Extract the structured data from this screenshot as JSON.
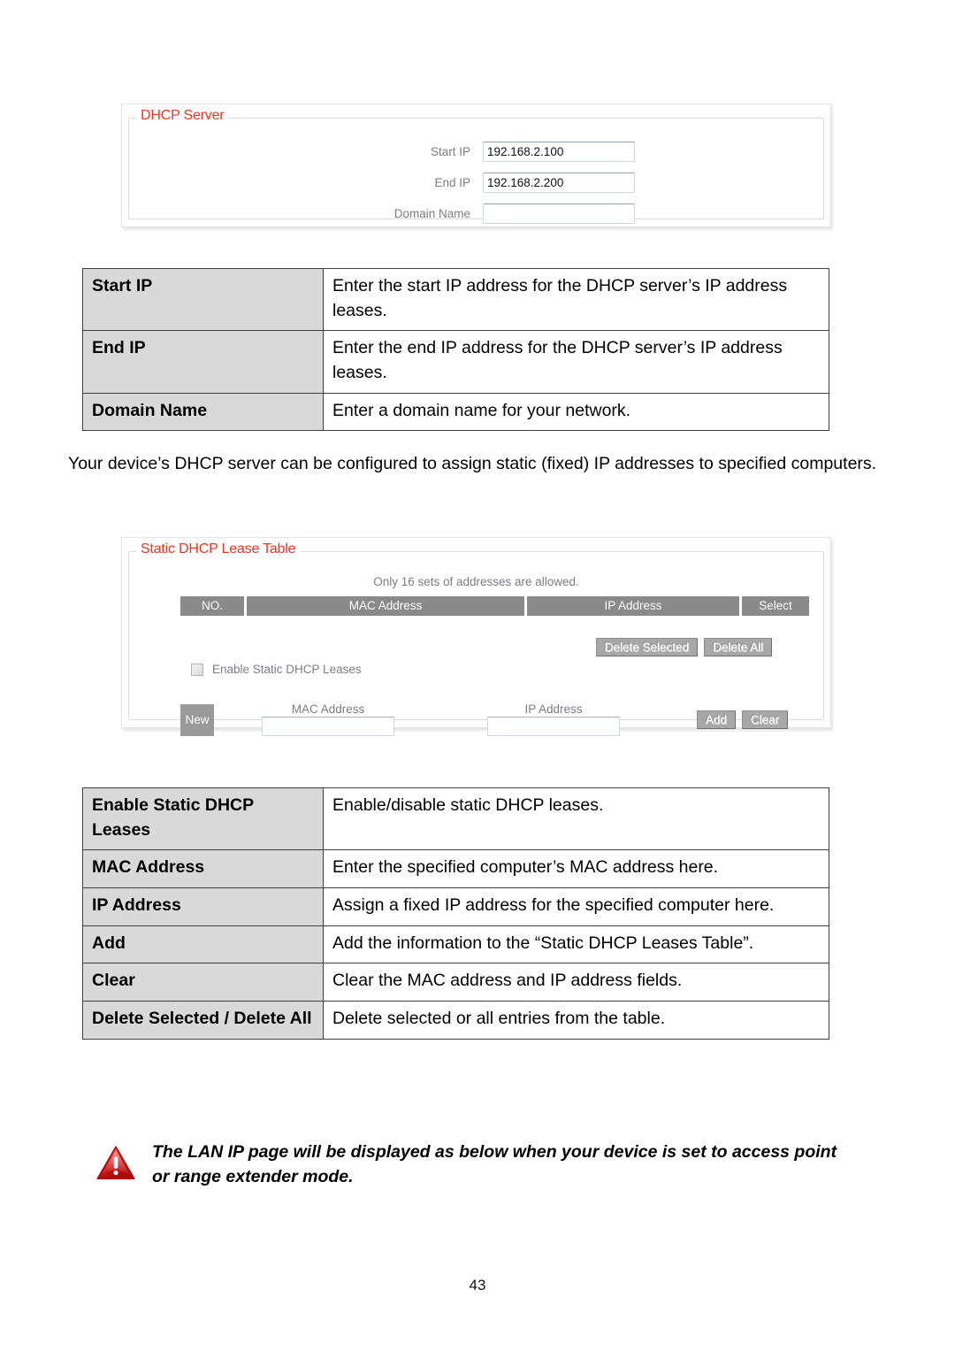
{
  "dhcp_server_panel": {
    "legend": "DHCP Server",
    "fields": [
      {
        "label": "Start IP",
        "value": "192.168.2.100"
      },
      {
        "label": "End IP",
        "value": "192.168.2.200"
      },
      {
        "label": "Domain Name",
        "value": ""
      }
    ]
  },
  "dhcp_desc_table": {
    "rows": [
      {
        "key": "Start IP",
        "value": "Enter the start IP address for the DHCP server’s IP address leases."
      },
      {
        "key": "End IP",
        "value": "Enter the end IP address for the DHCP server’s IP address leases."
      },
      {
        "key": "Domain Name",
        "value": "Enter a domain name for your network."
      }
    ]
  },
  "paragraph": "Your device’s DHCP server can be configured to assign static (fixed) IP addresses to specified computers.",
  "static_lease_panel": {
    "legend": "Static DHCP Lease Table",
    "note": "Only 16 sets of addresses are allowed.",
    "columns": [
      "NO.",
      "MAC Address",
      "IP Address",
      "Select"
    ],
    "delete_selected_label": "Delete Selected",
    "delete_all_label": "Delete All",
    "enable_checkbox_label": "Enable Static DHCP Leases",
    "new_label": "New",
    "mac_caption": "MAC Address",
    "mac_value": "",
    "ip_caption": "IP Address",
    "ip_value": "",
    "add_label": "Add",
    "clear_label": "Clear"
  },
  "static_desc_table": {
    "rows": [
      {
        "key": "Enable Static DHCP Leases",
        "value": "Enable/disable static DHCP leases."
      },
      {
        "key": "MAC Address",
        "value": "Enter the specified computer’s MAC address here."
      },
      {
        "key": "IP Address",
        "value": "Assign a fixed IP address for the specified computer here."
      },
      {
        "key": "Add",
        "value": "Add the information to the “Static DHCP Leases Table”."
      },
      {
        "key": "Clear",
        "value": "Clear the MAC address and IP address fields."
      },
      {
        "key": "Delete Selected / Delete All",
        "value": "Delete selected or all entries from the table."
      }
    ]
  },
  "warning": {
    "icon": "warning-triangle-icon",
    "text": "The LAN IP page will be displayed as below when your device is set to access point or range extender mode."
  },
  "page_number": "43",
  "colors": {
    "legend_red": "#e8361f",
    "table_key_bg": "#d9d9d9",
    "table_border": "#3f3f3f",
    "ui_gray": "#8a8a8a",
    "label_gray": "#7c7c8a"
  }
}
